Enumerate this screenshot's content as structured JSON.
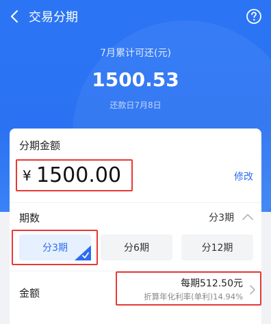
{
  "header": {
    "title": "交易分期",
    "summary_label": "7月累计可还(元)",
    "summary_amount": "1500.53",
    "repay_date": "还款日7月8日"
  },
  "amount": {
    "label": "分期金额",
    "currency": "¥",
    "value": "1500.00",
    "modify_label": "修改"
  },
  "term": {
    "label": "期数",
    "current": "分3期",
    "options": [
      "分3期",
      "分6期",
      "分12期"
    ],
    "selected_index": 0
  },
  "payment": {
    "label": "金额",
    "per_period": "每期512.50元",
    "rate": "折算年化利率(单利)14.94%"
  },
  "colors": {
    "brand_blue": "#2a72f2",
    "link_blue": "#2a6df0",
    "highlight_red": "#e53935"
  },
  "icons": [
    "back-icon",
    "help-icon",
    "chevron-up-icon",
    "check-icon",
    "chevron-right-icon"
  ]
}
